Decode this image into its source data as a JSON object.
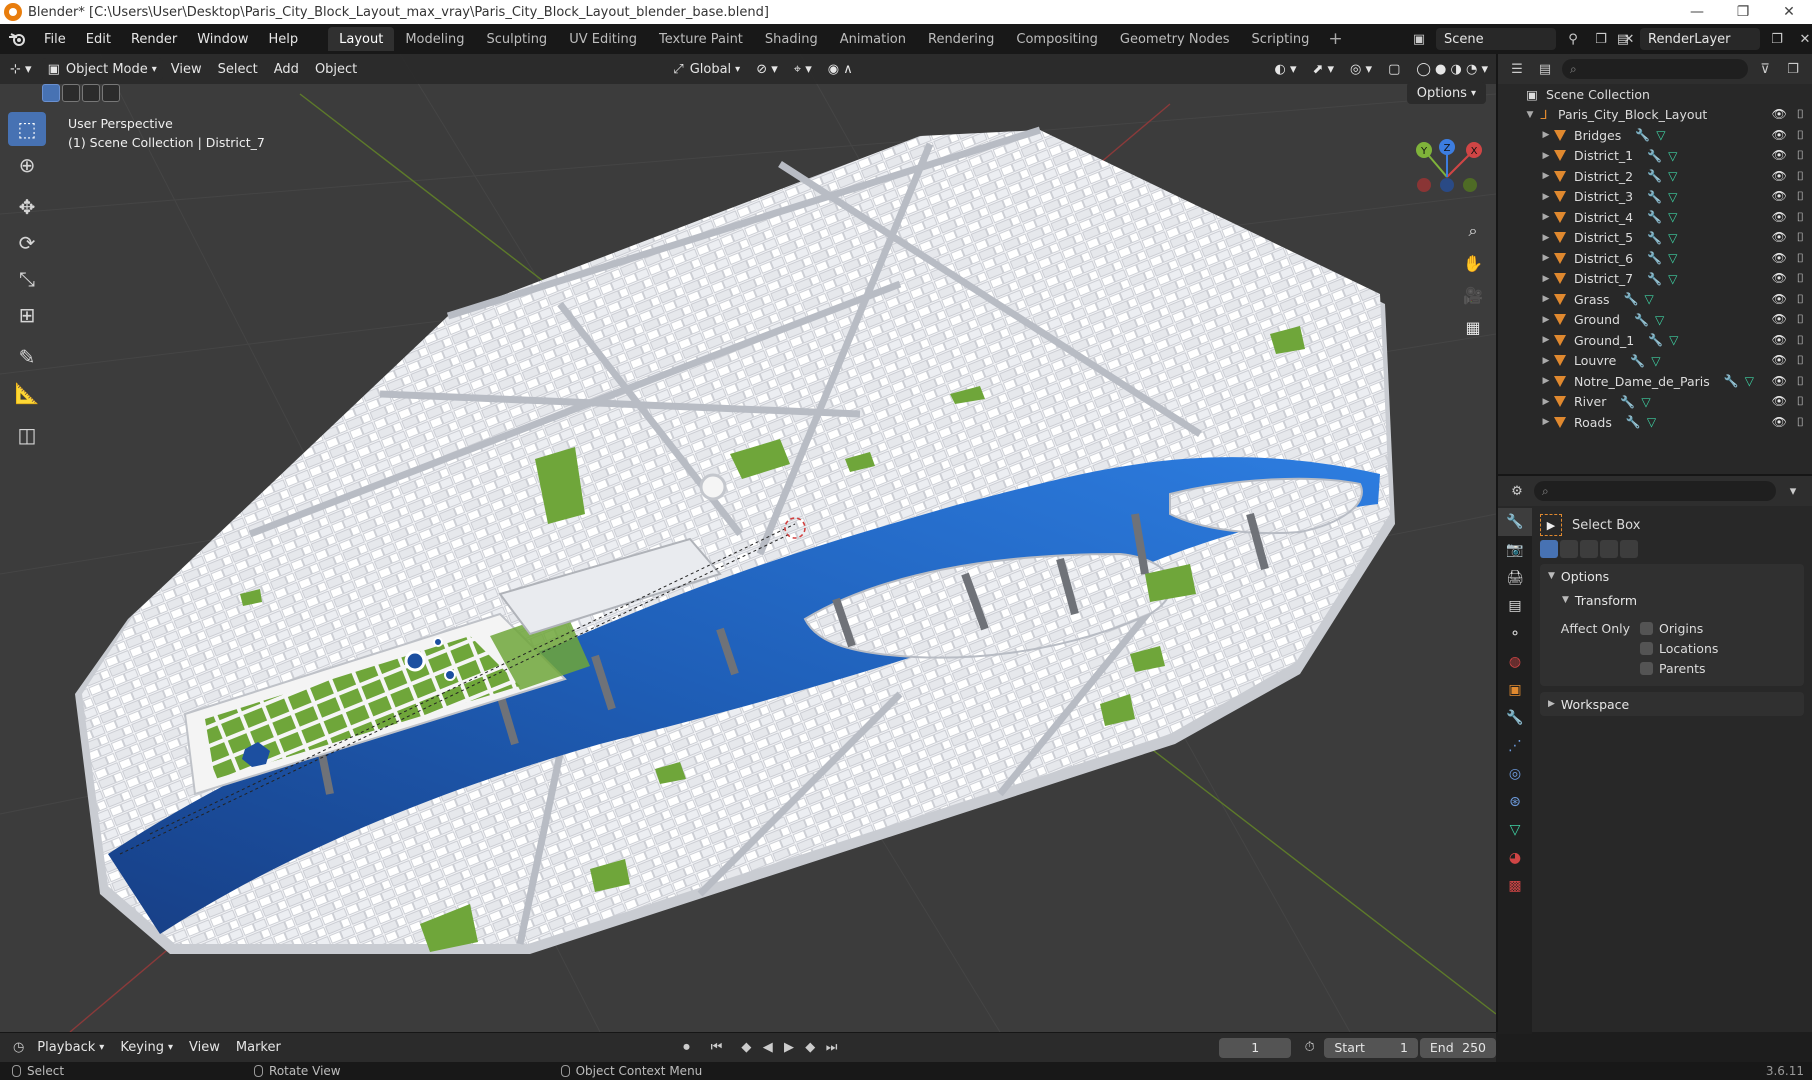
{
  "window": {
    "title": "Blender* [C:\\Users\\User\\Desktop\\Paris_City_Block_Layout_max_vray\\Paris_City_Block_Layout_blender_base.blend]",
    "minimize": "—",
    "maximize": "❐",
    "close": "✕"
  },
  "menu": [
    "File",
    "Edit",
    "Render",
    "Window",
    "Help"
  ],
  "workspaces": [
    "Layout",
    "Modeling",
    "Sculpting",
    "UV Editing",
    "Texture Paint",
    "Shading",
    "Animation",
    "Rendering",
    "Compositing",
    "Geometry Nodes",
    "Scripting"
  ],
  "active_workspace": "Layout",
  "scene": {
    "name": "Scene",
    "view_layer": "RenderLayer"
  },
  "viewport": {
    "mode": "Object Mode",
    "menus": [
      "View",
      "Select",
      "Add",
      "Object"
    ],
    "orientation": "Global",
    "options_label": "Options",
    "info_line1": "User Perspective",
    "info_line2": "(1) Scene Collection | District_7",
    "gizmo": {
      "x": "X",
      "y": "Y",
      "z": "Z"
    }
  },
  "outliner": {
    "root": "Scene Collection",
    "collection": "Paris_City_Block_Layout",
    "items": [
      {
        "label": "Bridges",
        "selected": false
      },
      {
        "label": "District_1",
        "selected": false
      },
      {
        "label": "District_2",
        "selected": false
      },
      {
        "label": "District_3",
        "selected": false
      },
      {
        "label": "District_4",
        "selected": false
      },
      {
        "label": "District_5",
        "selected": false
      },
      {
        "label": "District_6",
        "selected": false
      },
      {
        "label": "District_7",
        "selected": false
      },
      {
        "label": "Grass",
        "selected": false
      },
      {
        "label": "Ground",
        "selected": false
      },
      {
        "label": "Ground_1",
        "selected": false
      },
      {
        "label": "Louvre",
        "selected": false
      },
      {
        "label": "Notre_Dame_de_Paris",
        "selected": false
      },
      {
        "label": "River",
        "selected": false
      },
      {
        "label": "Roads",
        "selected": false
      }
    ]
  },
  "properties": {
    "tool_name": "Select Box",
    "options_label": "Options",
    "transform_label": "Transform",
    "affect_only_label": "Affect Only",
    "checkboxes": [
      "Origins",
      "Locations",
      "Parents"
    ],
    "workspace_label": "Workspace"
  },
  "timeline": {
    "menus": [
      "Playback",
      "Keying",
      "View",
      "Marker"
    ],
    "current_frame": "1",
    "start_label": "Start",
    "start": "1",
    "end_label": "End",
    "end": "250"
  },
  "status": {
    "select": "Select",
    "rotate": "Rotate View",
    "context": "Object Context Menu",
    "version": "3.6.11"
  },
  "colors": {
    "accent": "#4772b3",
    "grass": "#6fa63a",
    "river": "#1f5fb8",
    "building": "#e8eaee",
    "grid_bg": "#3c3c3c"
  }
}
